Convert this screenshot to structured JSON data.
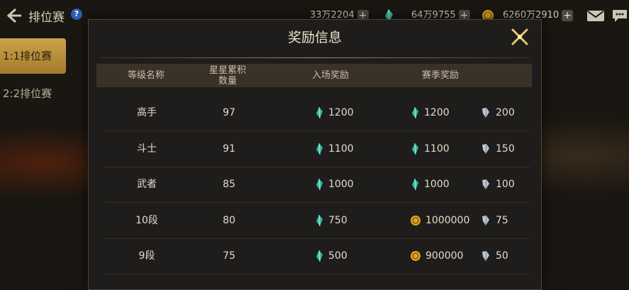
{
  "header": {
    "title": "排位赛",
    "help_icon": "?",
    "resources": [
      {
        "icon": "moon-currency-icon",
        "value": "33万2204"
      },
      {
        "icon": "jade-gem-icon",
        "value": "64万9755"
      },
      {
        "icon": "gold-coin-icon",
        "value": "6260万2910"
      }
    ]
  },
  "tabs": [
    {
      "label": "1:1排位赛",
      "active": true
    },
    {
      "label": "2:2排位赛",
      "active": false
    }
  ],
  "modal": {
    "title": "奖励信息",
    "columns": {
      "rank": "等级名称",
      "stars_line1": "星星累积",
      "stars_line2": "数量",
      "entry": "入场奖励",
      "season": "赛季奖励"
    },
    "rows": [
      {
        "rank": "高手",
        "stars": "97",
        "entry": "1200",
        "season_main_type": "gem",
        "season_main": "1200",
        "season_extra": "200"
      },
      {
        "rank": "斗士",
        "stars": "91",
        "entry": "1100",
        "season_main_type": "gem",
        "season_main": "1100",
        "season_extra": "150"
      },
      {
        "rank": "武者",
        "stars": "85",
        "entry": "1000",
        "season_main_type": "gem",
        "season_main": "1000",
        "season_extra": "100"
      },
      {
        "rank": "10段",
        "stars": "80",
        "entry": "750",
        "season_main_type": "coin",
        "season_main": "1000000",
        "season_extra": "75"
      },
      {
        "rank": "9段",
        "stars": "75",
        "entry": "500",
        "season_main_type": "coin",
        "season_main": "900000",
        "season_extra": "50"
      }
    ]
  },
  "colors": {
    "accent_gold": "#c9a24a",
    "gem_teal": "#2fbfa6",
    "coin_gold": "#e0a520"
  }
}
